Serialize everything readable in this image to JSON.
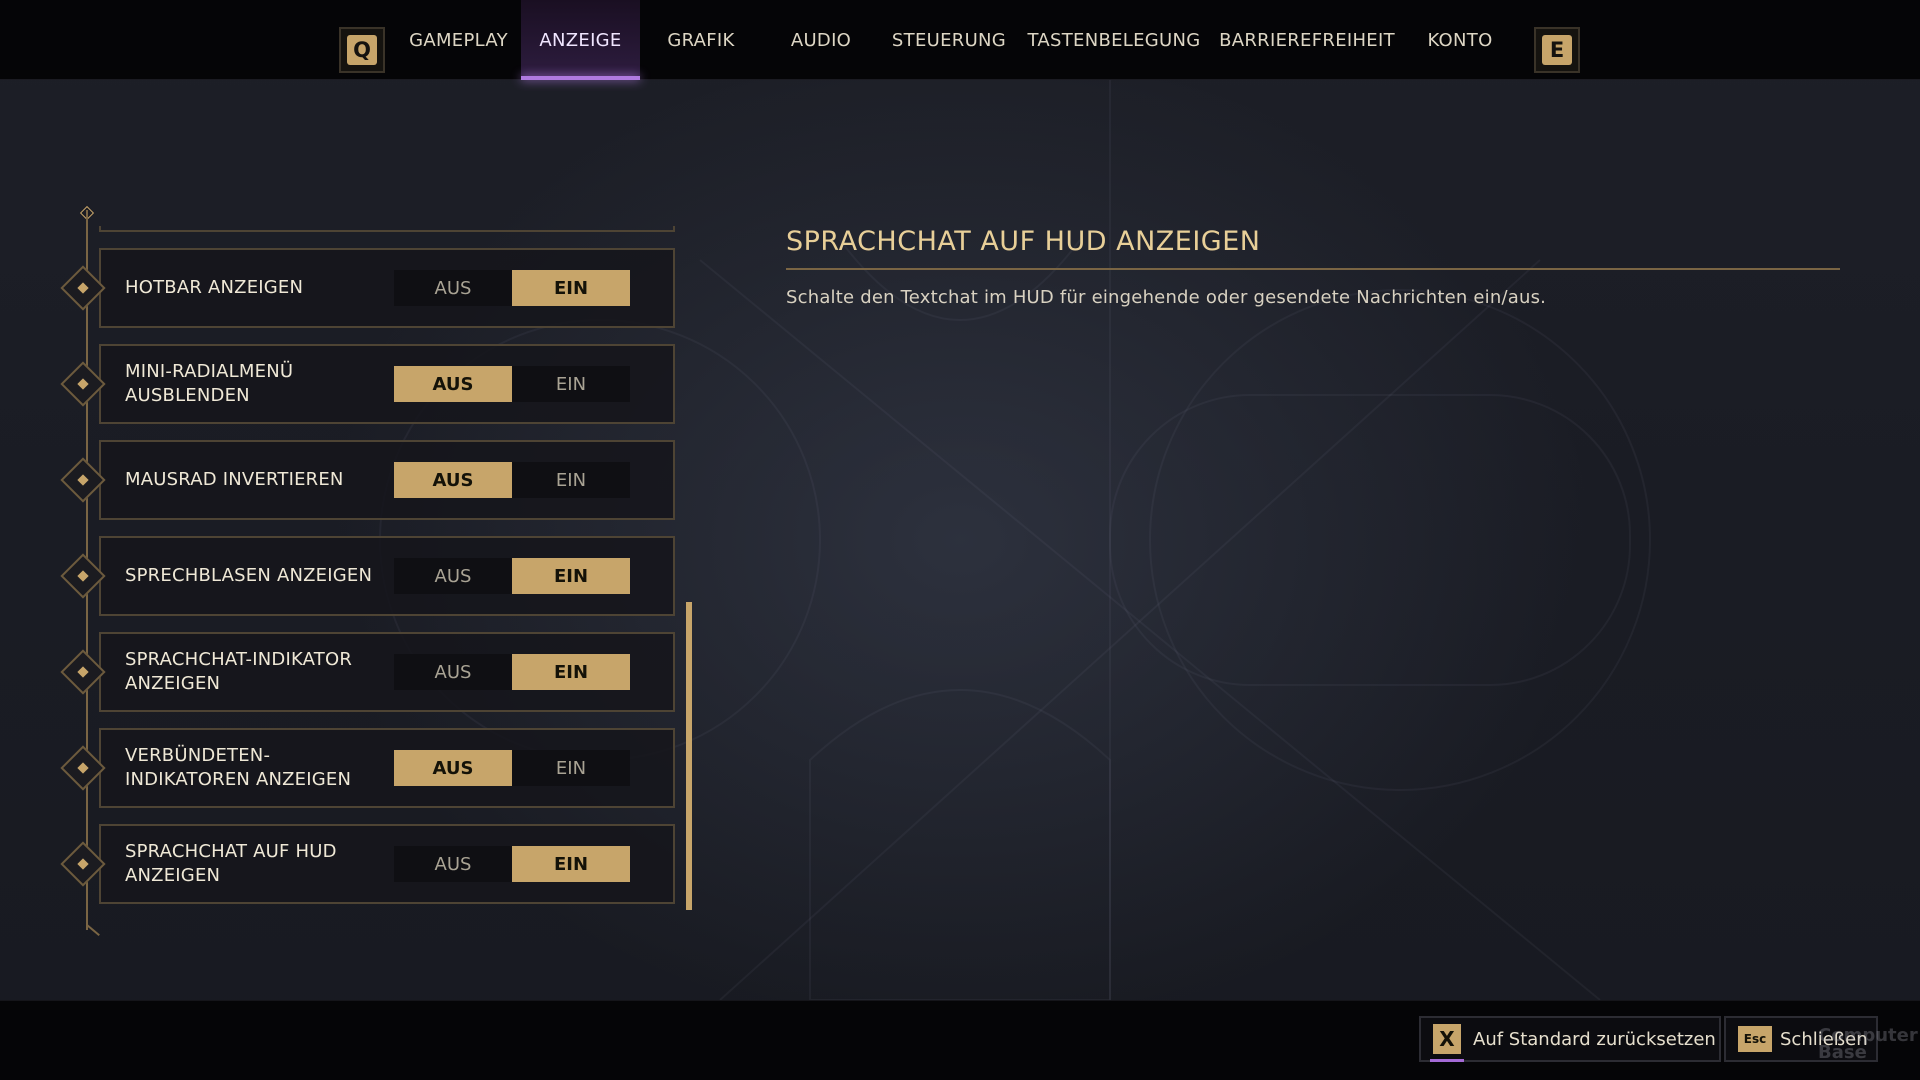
{
  "nav": {
    "prev_key": "Q",
    "next_key": "E",
    "tabs": [
      {
        "label": "GAMEPLAY"
      },
      {
        "label": "ANZEIGE",
        "active": true
      },
      {
        "label": "GRAFIK"
      },
      {
        "label": "AUDIO"
      },
      {
        "label": "STEUERUNG"
      },
      {
        "label": "TASTENBELEGUNG"
      },
      {
        "label": "BARRIEREFREIHEIT"
      },
      {
        "label": "KONTO"
      }
    ]
  },
  "settings": {
    "off_label": "AUS",
    "on_label": "EIN",
    "items": [
      {
        "label": "HOTBAR ANZEIGEN",
        "value": "EIN"
      },
      {
        "label": "MINI-RADIALMENÜ AUSBLENDEN",
        "value": "AUS"
      },
      {
        "label": "MAUSRAD INVERTIEREN",
        "value": "AUS"
      },
      {
        "label": "SPRECHBLASEN ANZEIGEN",
        "value": "EIN"
      },
      {
        "label": "SPRACHCHAT-INDIKATOR ANZEIGEN",
        "value": "EIN"
      },
      {
        "label": "VERBÜNDETEN-INDIKATOREN ANZEIGEN",
        "value": "AUS"
      },
      {
        "label": "SPRACHCHAT AUF HUD ANZEIGEN",
        "value": "EIN"
      }
    ]
  },
  "detail": {
    "title": "SPRACHCHAT AUF HUD ANZEIGEN",
    "description": "Schalte den Textchat im HUD für eingehende oder gesendete Nachrichten ein/aus."
  },
  "footer": {
    "reset_key": "X",
    "reset_label": "Auf Standard zurücksetzen",
    "close_key": "Esc",
    "close_label": "Schließen",
    "watermark": "Computer Base"
  },
  "colors": {
    "accent_gold": "#c7a56a",
    "active_tab": "#b07ae0"
  }
}
